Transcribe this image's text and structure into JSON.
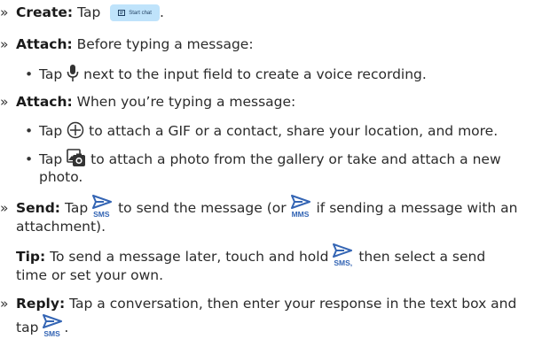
{
  "icons": {
    "accent_color": "#3465b4",
    "chip_bg": "#bfe3fb",
    "mic": "microphone-icon",
    "plus": "circle-plus-icon",
    "gallery": "gallery-camera-icon",
    "send": "send-arrow-icon"
  },
  "create": {
    "label": "Create:",
    "text": "Tap",
    "chip_label": "Start chat",
    "end": "."
  },
  "attach1": {
    "label": "Attach:",
    "text": "Before typing a message:"
  },
  "attach1_bullet": {
    "pre": "Tap",
    "post": "next to the input field to create a voice recording."
  },
  "attach2": {
    "label": "Attach:",
    "text": "When you’re typing a message:"
  },
  "attach2_bullet1": {
    "pre": "Tap",
    "post": "to attach a GIF or a contact, share your location, and more."
  },
  "attach2_bullet2": {
    "pre": "Tap",
    "post": "to attach a photo from the gallery or take and attach a new",
    "cont": "photo."
  },
  "send": {
    "label": "Send:",
    "pre": "Tap",
    "sms": "SMS",
    "mid": "to send the message (or",
    "mms": "MMS",
    "post": "if sending a message with an",
    "cont": "attachment)."
  },
  "tip": {
    "label": "Tip:",
    "pre": "To send a message later, touch and hold",
    "sms": "SMS,",
    "post": "then select a send",
    "cont": "time or set your own."
  },
  "reply": {
    "label": "Reply:",
    "text": "Tap a conversation, then enter your response in the text box and",
    "cont_pre": "tap",
    "sms": "SMS",
    "end": "."
  }
}
